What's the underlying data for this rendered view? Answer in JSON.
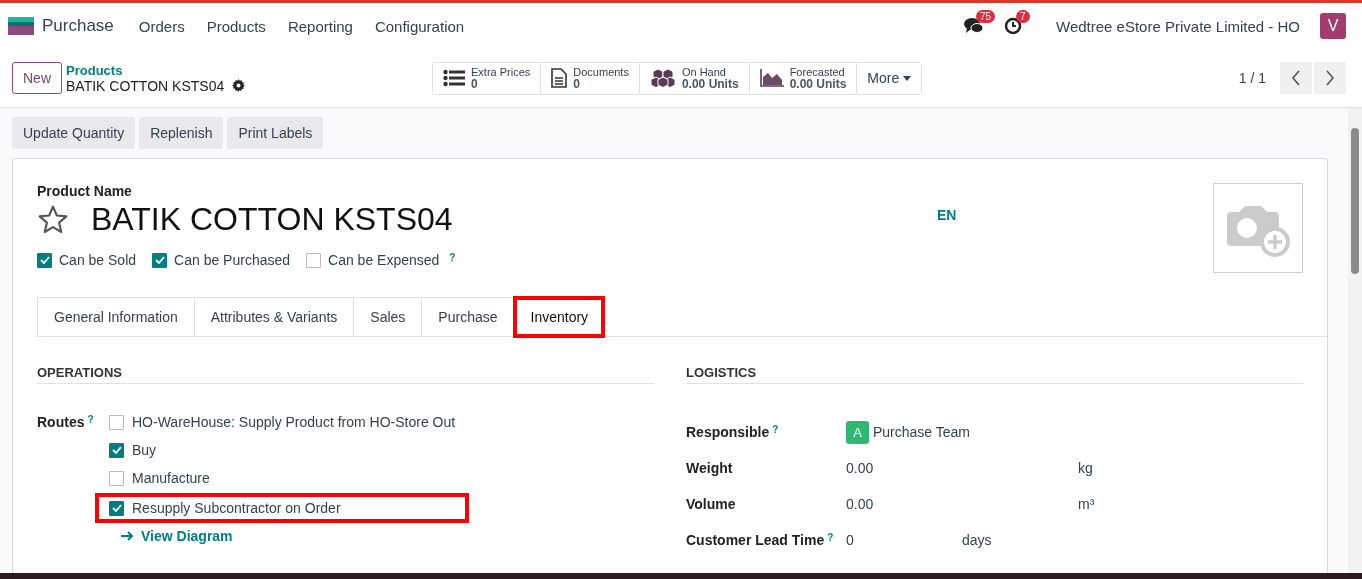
{
  "app": {
    "name": "Purchase",
    "menu": [
      "Orders",
      "Products",
      "Reporting",
      "Configuration"
    ]
  },
  "systray": {
    "messages_count": "75",
    "activities_count": "7",
    "company": "Wedtree eStore Private Limited - HO",
    "avatar": "V"
  },
  "control_panel": {
    "new_button": "New",
    "breadcrumb": "Products",
    "record": "BATIK COTTON KSTS04",
    "smart_buttons": [
      {
        "kind": "list",
        "label": "Extra Prices",
        "value": "0"
      },
      {
        "kind": "document",
        "label": "Documents",
        "value": "0"
      },
      {
        "kind": "boxes",
        "label": "On Hand",
        "value": "0.00 Units"
      },
      {
        "kind": "chart",
        "label": "Forecasted",
        "value": "0.00 Units"
      }
    ],
    "more_button": "More",
    "pager": "1 / 1"
  },
  "actions": [
    "Update Quantity",
    "Replenish",
    "Print Labels"
  ],
  "form": {
    "name_label": "Product Name",
    "name": "BATIK COTTON KSTS04",
    "favorite": false,
    "language": "EN",
    "options": [
      {
        "label": "Can be Sold",
        "checked": true
      },
      {
        "label": "Can be Purchased",
        "checked": true
      },
      {
        "label": "Can be Expensed",
        "checked": false,
        "help": "?"
      }
    ],
    "tabs": [
      {
        "label": "General Information",
        "selected": false,
        "highlighted": false
      },
      {
        "label": "Attributes & Variants",
        "selected": false,
        "highlighted": false
      },
      {
        "label": "Sales",
        "selected": false,
        "highlighted": false
      },
      {
        "label": "Purchase",
        "selected": false,
        "highlighted": false
      },
      {
        "label": "Inventory",
        "selected": true,
        "highlighted": true
      }
    ],
    "operations": {
      "title": "OPERATIONS",
      "routes_label": "Routes",
      "routes_help": "?",
      "routes": [
        {
          "label": "HO-WareHouse: Supply Product from HO-Store Out",
          "checked": false,
          "highlighted": false
        },
        {
          "label": "Buy",
          "checked": true,
          "highlighted": false
        },
        {
          "label": "Manufacture",
          "checked": false,
          "highlighted": false
        },
        {
          "label": "Resupply Subcontractor on Order",
          "checked": true,
          "highlighted": true
        }
      ],
      "link": "View Diagram"
    },
    "logistics": {
      "title": "LOGISTICS",
      "fields": [
        {
          "kind": "user",
          "label": "Responsible",
          "help": "?",
          "avatar": "A",
          "value": "Purchase Team"
        },
        {
          "kind": "measure",
          "label": "Weight",
          "value": "0.00",
          "unit": "kg"
        },
        {
          "kind": "measure",
          "label": "Volume",
          "value": "0.00",
          "unit": "m³"
        },
        {
          "kind": "short",
          "label": "Customer Lead Time",
          "help": "?",
          "value": "0",
          "unit": "days"
        }
      ]
    }
  }
}
